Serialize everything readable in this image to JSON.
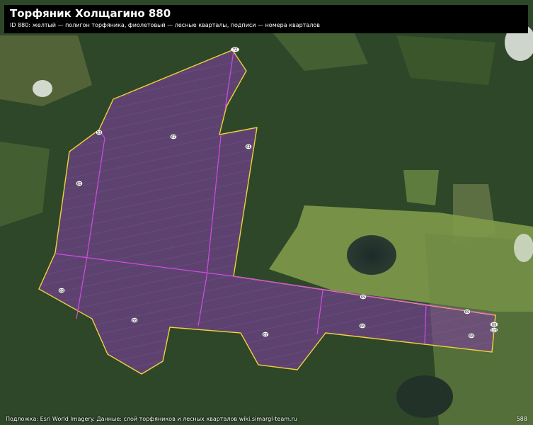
{
  "map": {
    "title": "Торфяник Холщагино 880",
    "subtitle": "ID 880: желтый — полигон торфяника, фиолетовый — лесные кварталы, подписи — номера кварталов",
    "attribution": "Подложка: Esri World Imagery. Данные: слой торфяников и лесных кварталов wiki.simargl-team.ru",
    "corner_label": "588",
    "colors": {
      "peat_outline": "#f2d23a",
      "quarter_line": "#d24be0",
      "peat_fill": "#7a3f9c"
    },
    "quarter_labels": [
      {
        "id": "q1",
        "text": "72"
      },
      {
        "id": "q2",
        "text": "53"
      },
      {
        "id": "q3",
        "text": "67"
      },
      {
        "id": "q4",
        "text": "61"
      },
      {
        "id": "q5",
        "text": "65"
      },
      {
        "id": "q6",
        "text": "63"
      },
      {
        "id": "q7",
        "text": "88"
      },
      {
        "id": "q8",
        "text": "67"
      },
      {
        "id": "q9",
        "text": "69"
      },
      {
        "id": "q10",
        "text": "68"
      },
      {
        "id": "q11",
        "text": "69"
      },
      {
        "id": "q12",
        "text": "68"
      },
      {
        "id": "q13",
        "text": "69"
      },
      {
        "id": "q14",
        "text": "115"
      }
    ]
  }
}
